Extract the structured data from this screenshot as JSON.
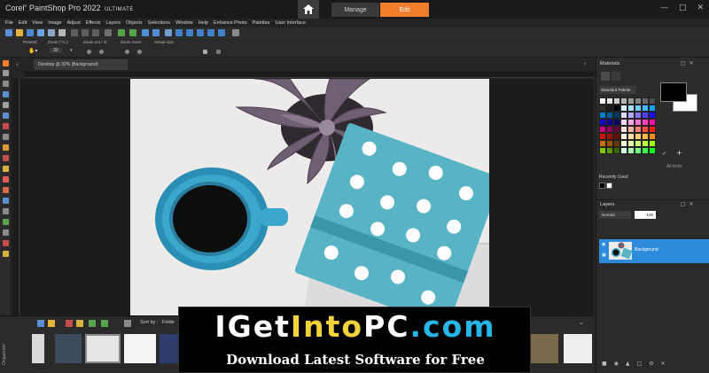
{
  "app": {
    "logo_brand": "Corel",
    "logo_name": "PaintShop Pro 2022",
    "logo_edition": "ULTIMATE",
    "tabs": {
      "manage": "Manage",
      "edit": "Edit"
    },
    "accent_color": "#f07e2c"
  },
  "menu": [
    "File",
    "Edit",
    "View",
    "Image",
    "Adjust",
    "Effects",
    "Layers",
    "Objects",
    "Selections",
    "Window",
    "Help",
    "Enhance Photo",
    "Palettes",
    "User Interface"
  ],
  "tool_options": {
    "presets_label": "Presets:",
    "zoom_label": "Zoom ( % ):",
    "zoom_value": "32",
    "zoom_out_in_label": "Zoom out / in:",
    "zoom_more_label": "Zoom more:",
    "actual_size_label": "Actual size:"
  },
  "document": {
    "tab_label": "Desktop @ 32% (Background)"
  },
  "organizer": {
    "vertical_label": "Organizer",
    "sort_by_label": "Sort by :",
    "folder_label": "Folde"
  },
  "materials": {
    "title": "Materials",
    "palette_select": "Standard Palette",
    "all_tools_label": "All tools",
    "recently_used_label": "Recently Used",
    "fg_color": "#000000",
    "bg_color": "#ffffff"
  },
  "layers": {
    "title": "Layers",
    "blend_mode": "Normal",
    "opacity": "100",
    "layer_name": "Background",
    "selected_color": "#2e8bdc"
  },
  "watermark": {
    "title_parts": [
      "I",
      "Get",
      "Into",
      "PC",
      ".com"
    ],
    "subtitle": "Download Latest Software for Free"
  }
}
